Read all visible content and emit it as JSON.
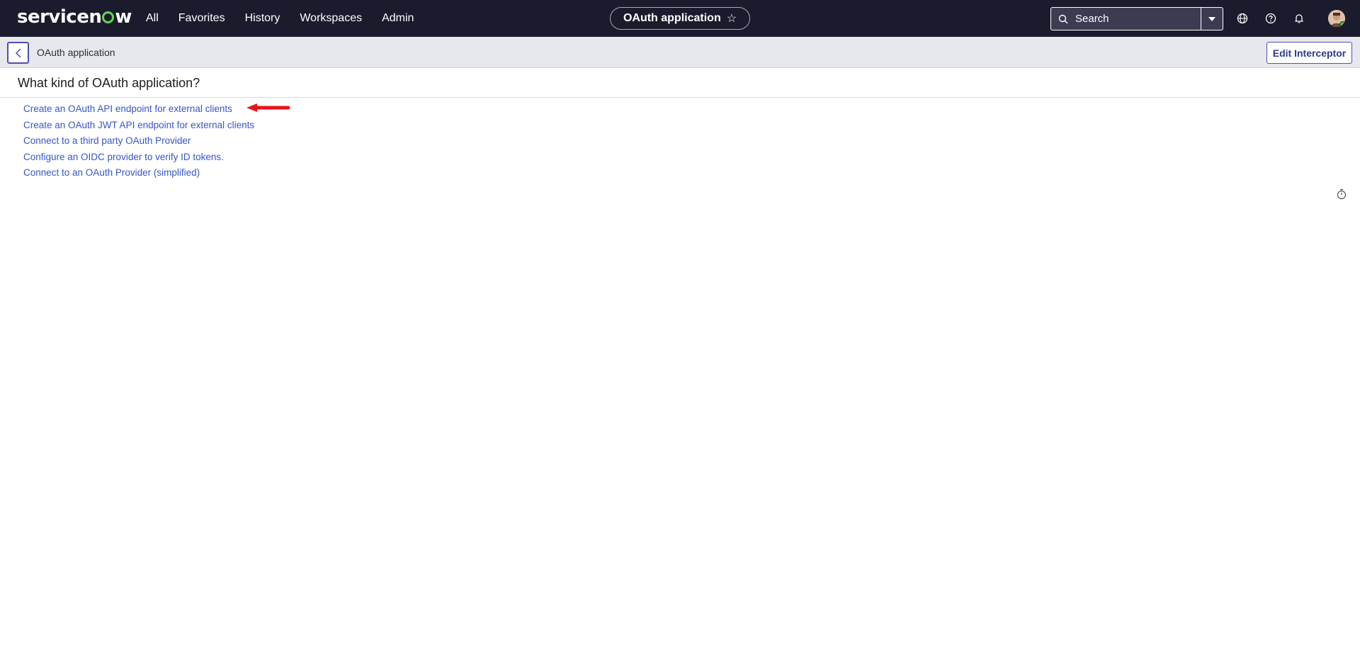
{
  "topnav": {
    "logo": {
      "prefix": "servicen",
      "suffix": "w"
    },
    "menu": [
      "All",
      "Favorites",
      "History",
      "Workspaces",
      "Admin"
    ],
    "context_title": "OAuth application",
    "search_placeholder": "Search",
    "icons": [
      "globe-icon",
      "help-icon",
      "bell-icon",
      "avatar"
    ]
  },
  "subheader": {
    "title": "OAuth application",
    "edit_button": "Edit Interceptor"
  },
  "main": {
    "question": "What kind of OAuth application?",
    "options": [
      "Create an OAuth API endpoint for external clients",
      "Create an OAuth JWT API endpoint for external clients",
      "Connect to a third party OAuth Provider",
      "Configure an OIDC provider to verify ID tokens.",
      "Connect to an OAuth Provider (simplified)"
    ]
  },
  "colors": {
    "nav_bg": "#1b1b2e",
    "link": "#3556c9",
    "accent_green": "#62d84e",
    "annotation_arrow": "#e8141c"
  }
}
